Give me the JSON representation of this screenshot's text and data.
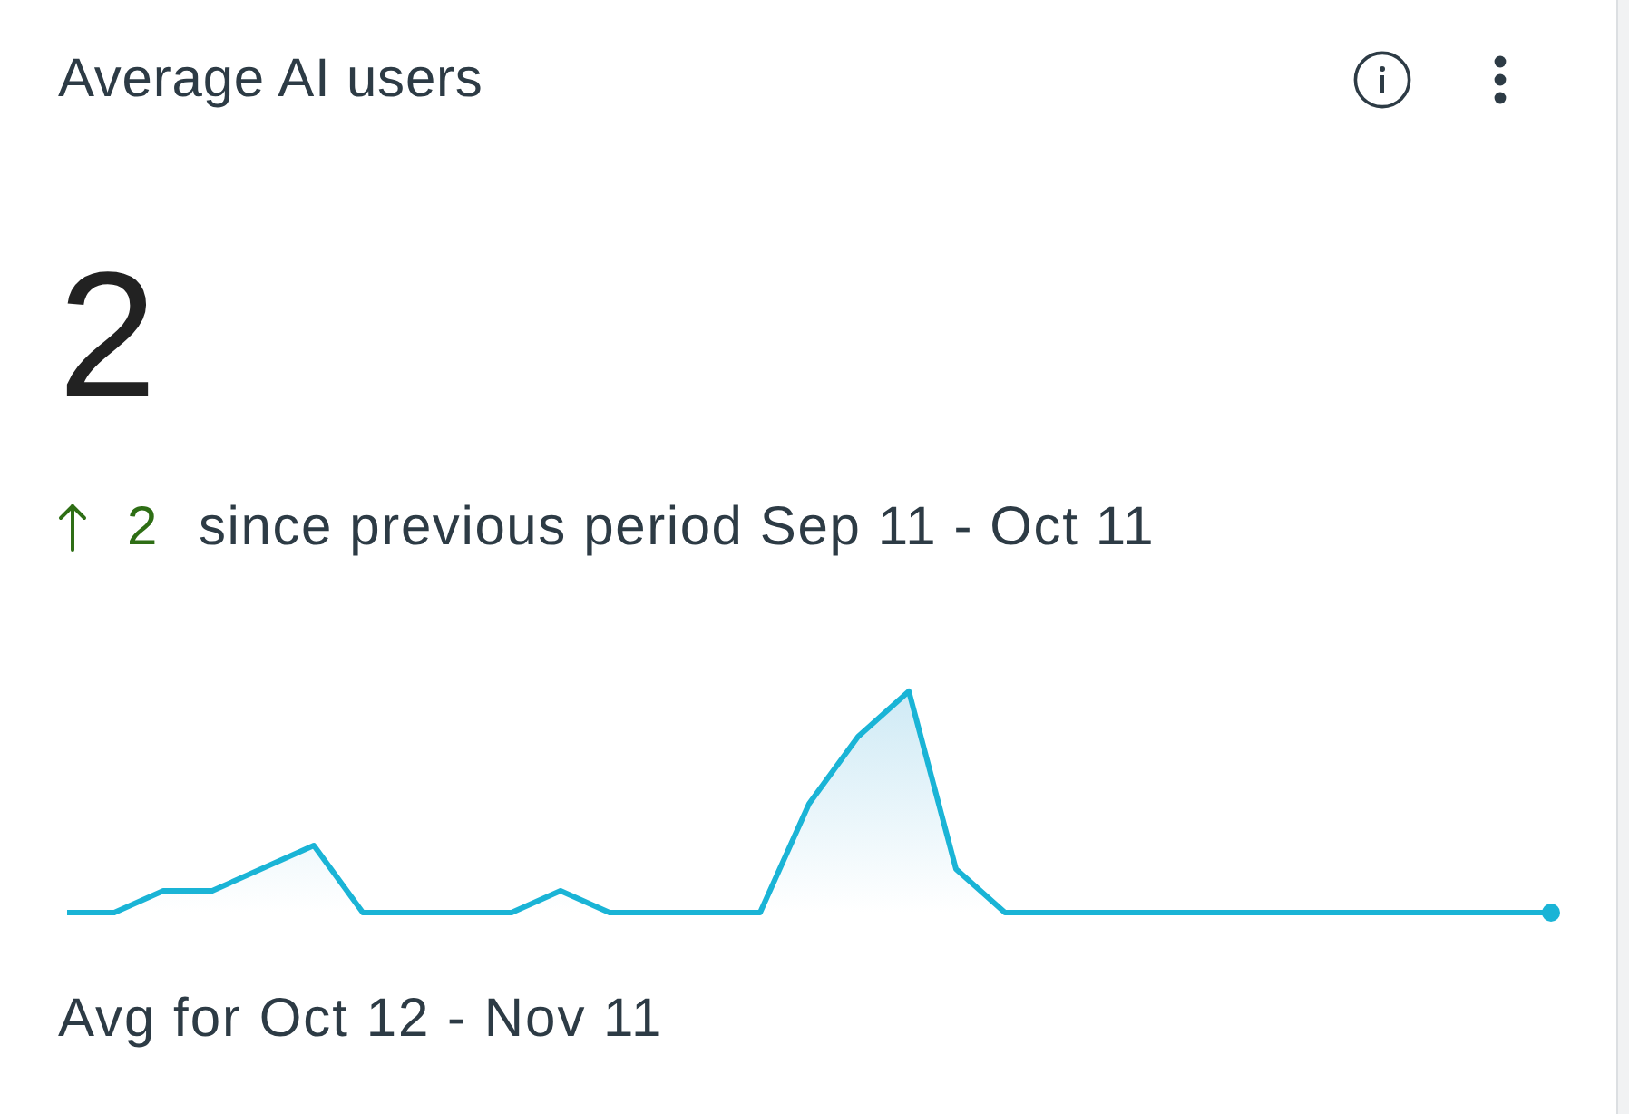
{
  "card": {
    "title": "Average AI users",
    "value": "2",
    "change": {
      "increase": true,
      "amount": "2",
      "label": "since previous period Sep 11 - Oct 11"
    },
    "footer": "Avg for Oct 12 - Nov 11"
  }
}
